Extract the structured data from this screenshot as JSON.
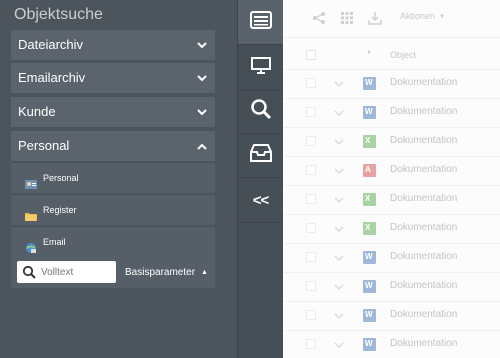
{
  "sidebar": {
    "title": "Objektsuche",
    "sections": [
      {
        "label": "Dateiarchiv"
      },
      {
        "label": "Emailarchiv"
      },
      {
        "label": "Kunde"
      },
      {
        "label": "Personal"
      }
    ],
    "personal_items": [
      {
        "label": "Personal",
        "icon": "person-card-icon"
      },
      {
        "label": "Register",
        "icon": "folder-icon"
      },
      {
        "label": "Email",
        "icon": "globe-mail-icon"
      }
    ],
    "search": {
      "placeholder": "Volltext",
      "value": ""
    },
    "basisparameter_label": "Basisparameter"
  },
  "rail": {
    "buttons": [
      "archive-tray-icon",
      "monitor-icon",
      "search-icon",
      "inbox-icon"
    ],
    "collapse_label": "<<"
  },
  "toolbar": {
    "actions_label": "Aktionen"
  },
  "table": {
    "column_header": "Object",
    "rows": [
      {
        "name": "Dokumentation",
        "type": "word"
      },
      {
        "name": "Dokumentation",
        "type": "word"
      },
      {
        "name": "Dokumentation",
        "type": "excel"
      },
      {
        "name": "Dokumentation",
        "type": "pdf"
      },
      {
        "name": "Dokumentation",
        "type": "excel"
      },
      {
        "name": "Dokumentation",
        "type": "excel"
      },
      {
        "name": "Dokumentation",
        "type": "word"
      },
      {
        "name": "Dokumentation",
        "type": "word"
      },
      {
        "name": "Dokumentation",
        "type": "word"
      },
      {
        "name": "Dokumentation",
        "type": "word"
      }
    ]
  },
  "colors": {
    "sidebar_bg": "#4c545c",
    "section_bg": "#5b646d",
    "word": "#9fb8d8",
    "excel": "#a9d3a4",
    "pdf": "#e7a3a3"
  }
}
